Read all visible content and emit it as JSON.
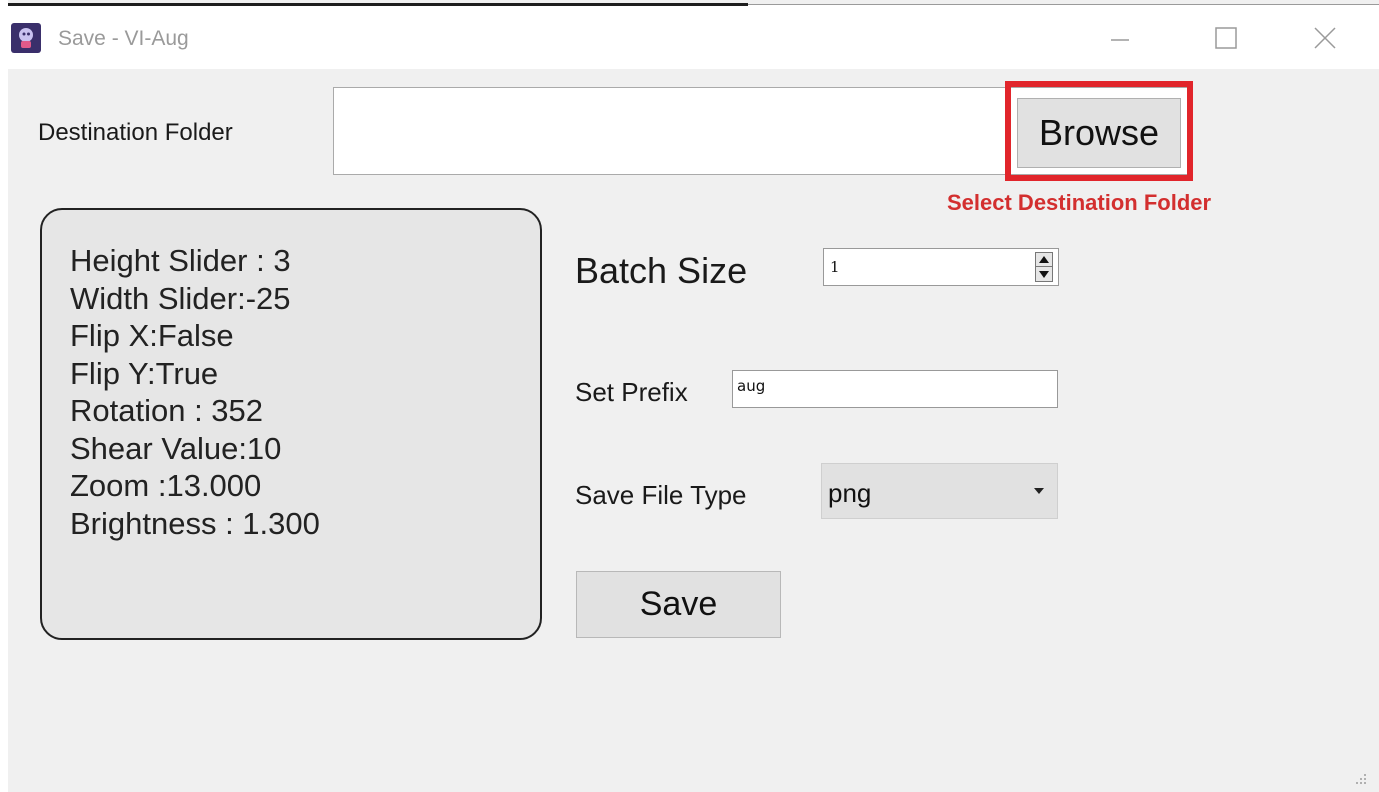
{
  "window": {
    "title": "Save - VI-Aug"
  },
  "destination": {
    "label": "Destination Folder",
    "value": "",
    "browse_label": "Browse",
    "annotation": "Select Destination Folder"
  },
  "info": {
    "lines": [
      "Height Slider : 3",
      "Width Slider:-25",
      "Flip X:False",
      "Flip Y:True",
      "Rotation : 352",
      "Shear Value:10",
      "Zoom :13.000",
      "Brightness : 1.300"
    ]
  },
  "batch": {
    "label": "Batch Size",
    "value": "1"
  },
  "prefix": {
    "label": "Set Prefix",
    "value": "aug"
  },
  "file_type": {
    "label": "Save File Type",
    "selected": "png"
  },
  "actions": {
    "save_label": "Save"
  },
  "colors": {
    "highlight": "#e1252b",
    "annotation_text": "#d32f2f",
    "background": "#f0f0f0"
  },
  "icons": {
    "app": "app-icon",
    "minimize": "minimize-icon",
    "maximize": "maximize-icon",
    "close": "close-icon",
    "spin_up": "arrow-up-icon",
    "spin_down": "arrow-down-icon",
    "dropdown": "chevron-down-icon",
    "resize": "resize-grip-icon"
  }
}
